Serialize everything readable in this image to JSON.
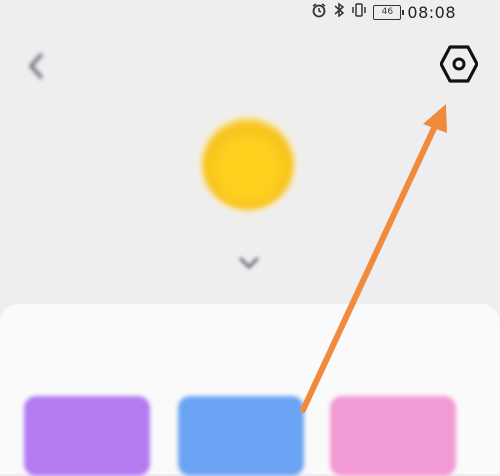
{
  "status_bar": {
    "carrier": "",
    "battery_label": "46",
    "time": "08:08"
  },
  "icons": {
    "back": "chevron-left-icon",
    "settings": "hexagon-settings-icon",
    "alarm": "alarm-icon",
    "bluetooth": "bluetooth-icon",
    "vibrate": "vibrate-icon",
    "battery": "battery-icon",
    "scene": "sun-icon",
    "expand": "chevron-down-icon"
  },
  "panel": {
    "title": "",
    "more": ""
  },
  "tiles": [
    {
      "label": "",
      "color": "#b47af0"
    },
    {
      "label": "",
      "color": "#6ba4f4"
    },
    {
      "label": "",
      "color": "#f29ad3"
    }
  ],
  "colors": {
    "annotation_arrow": "#f08a3c",
    "sun": "#ffd21a"
  }
}
